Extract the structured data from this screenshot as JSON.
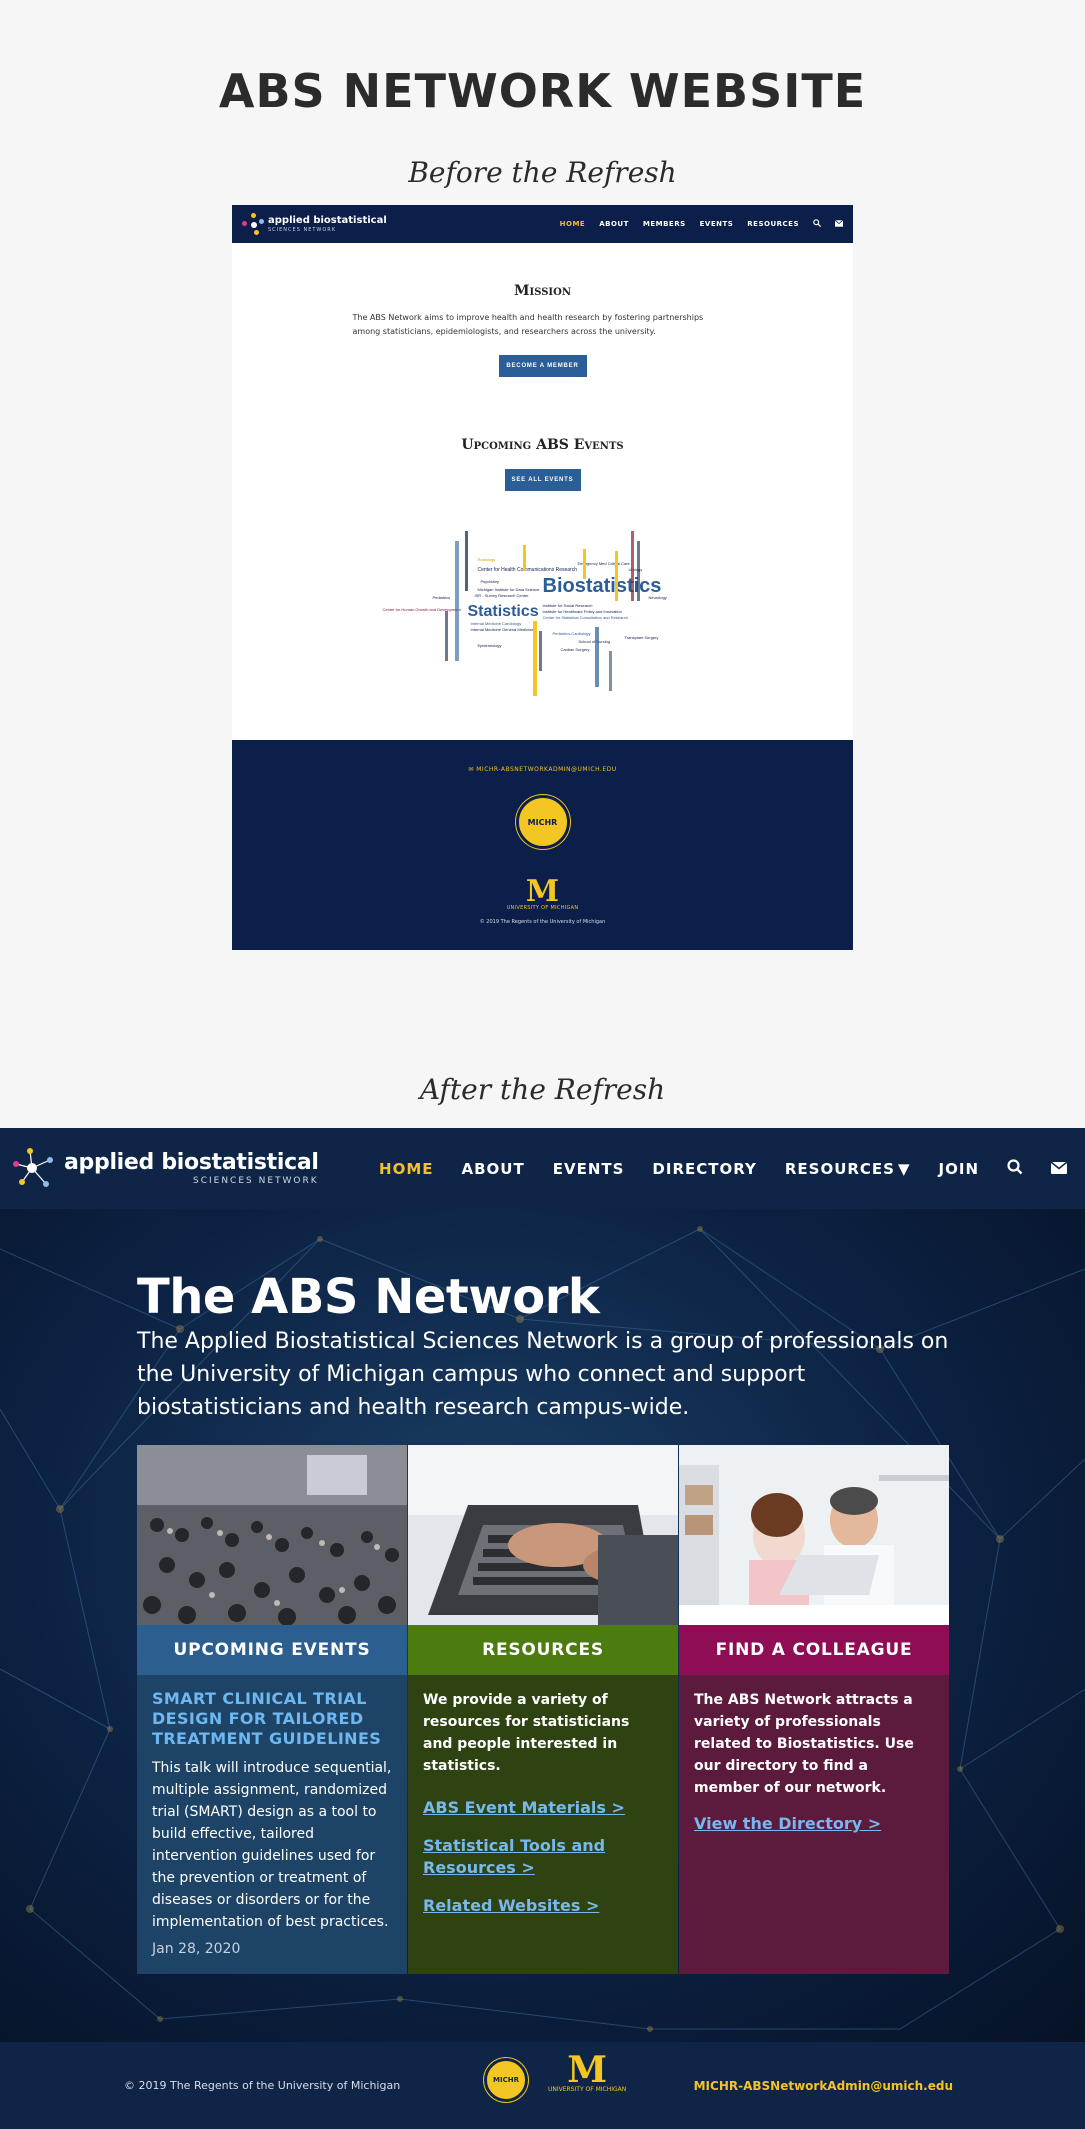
{
  "page": {
    "title": "ABS NETWORK WEBSITE",
    "before_caption": "Before the Refresh",
    "after_caption": "After the Refresh"
  },
  "before": {
    "logo": {
      "main": "applied biostatistical",
      "sub": "SCIENCES NETWORK"
    },
    "nav": [
      "HOME",
      "ABOUT",
      "MEMBERS",
      "EVENTS",
      "RESOURCES"
    ],
    "nav_active": "HOME",
    "icons": [
      "search-icon",
      "envelope-icon"
    ],
    "mission_heading": "Mission",
    "mission_text": "The ABS Network aims to improve health and health research by fostering partnerships among statisticians, epidemiologists, and researchers across the university.",
    "become_member_button": "BECOME A MEMBER",
    "events_heading": "Upcoming ABS Events",
    "see_events_button": "SEE ALL EVENTS",
    "word_cloud": {
      "biostatistics": "Biostatistics",
      "statistics": "Statistics",
      "w1": "Center for Health Communications Research",
      "w2": "Center for Human Growth and Development",
      "w3": "Michigan Institute for Data Science",
      "w4": "Institute for Social Research",
      "w5": "School of Nursing",
      "w6": "Epidemiology",
      "w7": "Internal Medicine Cardiology",
      "w8": "Pediatrics-Cardiology",
      "w9": "Transplant Surgery",
      "w10": "Cardiac Surgery",
      "w11": "Emergency Med Critical Care",
      "w12": "Psychiatry",
      "w13": "Pediatrics",
      "w14": "Urology",
      "w15": "ISR - Survey Research Center",
      "w16": "Internal Medicine General Medicine",
      "w17": "Center for Statistical Consultation and Research",
      "w18": "Institute for Healthcare Policy and Innovation",
      "w19": "Radiology",
      "w20": "Neurology"
    },
    "footer_email": "MICHR-ABSNETWORKADMIN@UMICH.EDU",
    "seal_text": "MICHR",
    "block_m": "M",
    "block_m_sub": "UNIVERSITY OF MICHIGAN",
    "copyright": "© 2019 The Regents of the University of Michigan"
  },
  "after": {
    "logo": {
      "main": "applied biostatistical",
      "sub": "SCIENCES NETWORK"
    },
    "nav": {
      "home": "HOME",
      "about": "ABOUT",
      "events": "EVENTS",
      "directory": "DIRECTORY",
      "resources": "RESOURCES",
      "join": "JOIN"
    },
    "nav_active": "HOME",
    "hero_title": "The ABS Network",
    "hero_desc": "The Applied Biostatistical Sciences Network is a group of professionals on the University of Michigan campus who connect and support biostatisticians and health research campus-wide.",
    "cards": {
      "events": {
        "heading": "UPCOMING EVENTS",
        "event_title": "SMART CLINICAL TRIAL DESIGN FOR TAILORED TREATMENT GUIDELINES",
        "event_desc": "This talk will introduce sequential, multiple assignment, randomized trial (SMART) design as a tool to build effective, tailored intervention guidelines used for the prevention or treatment of diseases or disorders or for the implementation of best practices.",
        "event_date": "Jan 28, 2020",
        "image": "conference-crowd-photo"
      },
      "resources": {
        "heading": "RESOURCES",
        "text": "We provide a variety of resources for statisticians and people interested in statistics.",
        "links": [
          "ABS Event Materials >",
          "Statistical Tools and Resources >",
          "Related Websites >"
        ],
        "image": "laptop-typing-photo"
      },
      "colleague": {
        "heading": "FIND A COLLEAGUE",
        "text": "The ABS Network attracts a variety of professionals related to Biostatistics. Use our directory to find a member of our network.",
        "link": "View the Directory >",
        "image": "colleagues-at-laptop-photo"
      }
    },
    "footer": {
      "copyright": "© 2019 The Regents of the University of Michigan",
      "seal_text": "MICHR",
      "block_m": "M",
      "block_m_sub": "UNIVERSITY OF MICHIGAN",
      "email": "MICHR-ABSNetworkAdmin@umich.edu"
    }
  },
  "colors": {
    "navy": "#0f2547",
    "gold": "#f4c22a",
    "events_blue": "#2c5f8f",
    "resources_green": "#4c7b10",
    "colleague_magenta": "#8e0d55"
  }
}
